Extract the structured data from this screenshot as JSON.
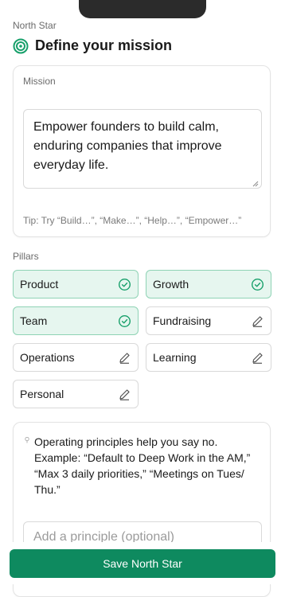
{
  "header": {
    "eyebrow": "North Star",
    "title": "Define your mission",
    "icon": "target-icon",
    "accent_color": "#18a06b"
  },
  "mission": {
    "label": "Mission",
    "value": "Empower founders to build calm, enduring companies that improve everyday life.",
    "tip": "Tip: Try “Build…”, “Make…”, “Help…”, “Empower…”"
  },
  "pillars": {
    "label": "Pillars",
    "items": [
      {
        "label": "Product",
        "selected": true,
        "icon": "check-circle-icon"
      },
      {
        "label": "Growth",
        "selected": true,
        "icon": "check-circle-icon"
      },
      {
        "label": "Team",
        "selected": true,
        "icon": "check-circle-icon"
      },
      {
        "label": "Fundraising",
        "selected": false,
        "icon": "pencil-icon"
      },
      {
        "label": "Operations",
        "selected": false,
        "icon": "pencil-icon"
      },
      {
        "label": "Learning",
        "selected": false,
        "icon": "pencil-icon"
      },
      {
        "label": "Personal",
        "selected": false,
        "icon": "pencil-icon"
      }
    ]
  },
  "principles": {
    "hint": "Operating principles help you say no. Example: “Default to Deep Work in the AM,” “Max 3 daily priorities,” “Meetings on Tues/ Thu.”",
    "placeholder": "Add a principle (optional)"
  },
  "footer": {
    "save_label": "Save North Star",
    "button_color": "#0e8a5f"
  }
}
